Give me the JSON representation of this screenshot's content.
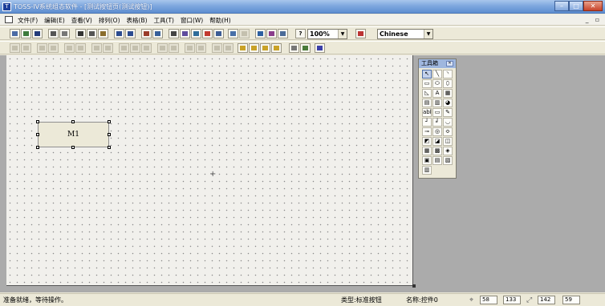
{
  "window": {
    "title": "TOSS-IV系统组态软件 - [测试按钮页(测试按钮)]",
    "app_icon": "app-icon",
    "buttons": [
      "minimize-button",
      "maximize-button",
      "close-button"
    ],
    "close_color": "#c7432a"
  },
  "menu": {
    "items": [
      "文件(F)",
      "编辑(E)",
      "查看(V)",
      "排列(O)",
      "表格(B)",
      "工具(T)",
      "窗口(W)",
      "帮助(H)"
    ],
    "mdi_controls": "_ ▫"
  },
  "toolbar1": {
    "zoom_value": "100%",
    "language_value": "Chinese",
    "icons": [
      "new-icon",
      "open-icon",
      "save-icon",
      "print-icon",
      "print-preview-icon",
      "cut-icon",
      "copy-icon",
      "paste-icon",
      "undo-icon",
      "redo-icon",
      "tool-icon",
      "align-icon",
      "draw-icon",
      "image-icon",
      "font-icon",
      "chart-icon",
      "table-icon",
      "grid-icon",
      "properties-icon",
      "check-icon",
      "compile-icon",
      "help-icon",
      "language-icon"
    ]
  },
  "toolbar2": {
    "icons": [
      "align-left-icon",
      "align-right-icon",
      "align-top-icon",
      "align-bottom-icon",
      "center-vertical-icon",
      "center-horizontal-icon",
      "same-width-icon",
      "same-height-icon",
      "same-size-icon",
      "space-across-icon",
      "space-down-icon",
      "space-even-icon",
      "bring-front-icon",
      "send-back-icon",
      "order-forward-icon",
      "order-backward-icon",
      "group-icon",
      "ungroup-icon",
      "lock-icon",
      "tab-order-icon",
      "grid-toggle-icon"
    ]
  },
  "canvas": {
    "control_label": "M1",
    "background": "#f1f0ec"
  },
  "toolbox": {
    "title": "工具箱",
    "tools": [
      "↖",
      "╲",
      "◝",
      "▭",
      "⬭",
      "⬯",
      "◺",
      "A",
      "▦",
      "▤",
      "▥",
      "◕",
      "abl",
      "▭",
      "✎",
      "┘",
      "╛",
      "◡",
      "⊸",
      "◎",
      "≎",
      "◩",
      "◪",
      "◫",
      "▦",
      "▩",
      "◈",
      "▣",
      "▤",
      "▧",
      "▥"
    ],
    "selected_tool": "pointer"
  },
  "status": {
    "message": "准备就绪，等待操作。",
    "type": "类型:标准按钮",
    "name": "名称:控件0",
    "x": "58",
    "y": "133",
    "width": "142",
    "height": "59"
  }
}
